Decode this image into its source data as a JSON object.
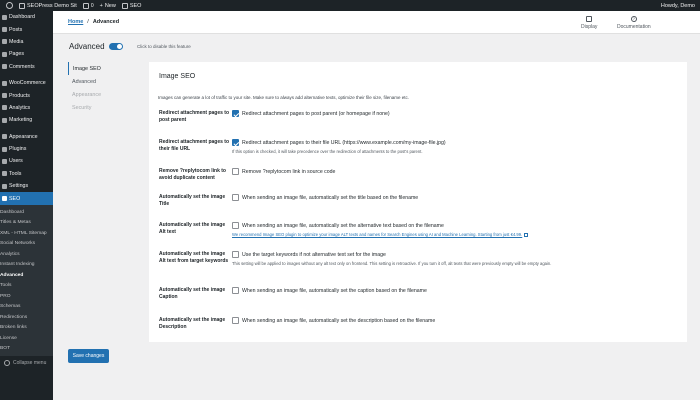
{
  "adminbar": {
    "site_name": "SEOPress Demo Sit",
    "comments_count": "0",
    "new_label": "New",
    "seo_label": "SEO",
    "greeting": "Howdy, Demo"
  },
  "sidebar": {
    "items": [
      {
        "label": "Dashboard",
        "icon": "dashboard-icon"
      },
      {
        "label": "Posts",
        "icon": "pin-icon"
      },
      {
        "label": "Media",
        "icon": "media-icon"
      },
      {
        "label": "Pages",
        "icon": "page-icon"
      },
      {
        "label": "Comments",
        "icon": "comment-icon"
      },
      {
        "label": "WooCommerce",
        "icon": "woo-icon"
      },
      {
        "label": "Products",
        "icon": "product-icon"
      },
      {
        "label": "Analytics",
        "icon": "chart-icon"
      },
      {
        "label": "Marketing",
        "icon": "megaphone-icon"
      },
      {
        "label": "Appearance",
        "icon": "brush-icon"
      },
      {
        "label": "Plugins",
        "icon": "plugin-icon"
      },
      {
        "label": "Users",
        "icon": "user-icon"
      },
      {
        "label": "Tools",
        "icon": "wrench-icon"
      },
      {
        "label": "Settings",
        "icon": "settings-icon"
      },
      {
        "label": "SEO",
        "icon": "seo-icon"
      }
    ],
    "submenu": [
      "Dashboard",
      "Titles & Metas",
      "XML - HTML Sitemap",
      "Social Networks",
      "Analytics",
      "Instant Indexing",
      "Advanced",
      "Tools",
      "PRO",
      "Schemas",
      "Redirections",
      "Broken links",
      "License",
      "BOT"
    ],
    "collapse_label": "Collapse menu"
  },
  "header": {
    "breadcrumb_home": "Home",
    "breadcrumb_sep": "/",
    "breadcrumb_current": "Advanced",
    "display_label": "Display",
    "documentation_label": "Documentation"
  },
  "page": {
    "title": "Advanced",
    "toggle_label": "Click to disable this feature"
  },
  "tabs": [
    "Image SEO",
    "Advanced",
    "Appearance",
    "Security"
  ],
  "card": {
    "title": "Image SEO",
    "intro": "Images can generate a lot of traffic to your site. Make sure to always add alternative texts, optimize their file size, filename etc.",
    "rows": [
      {
        "label": "Redirect attachment pages to post parent",
        "checkbox": "Redirect attachment pages to post parent (or homepage if none)",
        "checked": true
      },
      {
        "label": "Redirect attachment pages to their file URL",
        "checkbox": "Redirect attachment pages to their file URL (https://www.example.com/my-image-file.jpg)",
        "checked": true,
        "desc": "If this option is checked, it will take precedence over the redirection of attachments to the post's parent."
      },
      {
        "label": "Remove ?replytocom link to avoid duplicate content",
        "checkbox": "Remove ?replytocom link in source code",
        "checked": false
      },
      {
        "label": "Automatically set the image Title",
        "checkbox": "When sending an image file, automatically set the title based on the filename",
        "checked": false
      },
      {
        "label": "Automatically set the image Alt text",
        "checkbox": "When sending an image file, automatically set the alternative text based on the filename",
        "checked": false,
        "link": "We recommend Image SEO plugin to optimize your image ALT texts and names for Search Engines using AI and Machine Learning. Starting from just €4.99."
      },
      {
        "label": "Automatically set the image Alt text from target keywords",
        "checkbox": "Use the target keywords if not alternative text set for the image",
        "checked": false,
        "desc": "This setting will be applied to images without any alt text only on frontend. This setting is retroactive. If you turn it off, alt texts that were previously empty will be empty again."
      },
      {
        "label": "Automatically set the image Caption",
        "checkbox": "When sending an image file, automatically set the caption based on the filename",
        "checked": false
      },
      {
        "label": "Automatically set the image Description",
        "checkbox": "When sending an image file, automatically set the description based on the filename",
        "checked": false
      }
    ]
  },
  "save_button": "Save changes",
  "colors": {
    "accent": "#2271b1",
    "sidebar_bg": "#1d2327",
    "submenu_bg": "#2c3338",
    "page_bg": "#f0f0f1"
  }
}
